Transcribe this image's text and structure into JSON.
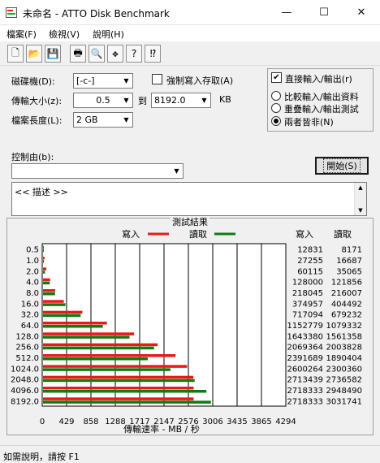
{
  "window": {
    "title": "未命名 - ATTO Disk Benchmark",
    "minimize": "—",
    "maximize": "☐",
    "close": "✕"
  },
  "menu": [
    "檔案(F)",
    "檢視(V)",
    "說明(H)"
  ],
  "toolbar": {
    "icons": [
      "new-icon",
      "open-icon",
      "save-icon",
      "print-icon",
      "print-preview-icon",
      "move-icon",
      "help-icon",
      "context-help-icon"
    ],
    "glyphs": [
      "🗋",
      "📂",
      "💾",
      "🖶",
      "🔍",
      "✥",
      "?",
      "⁉"
    ]
  },
  "settings": {
    "drive_label": "磁碟機(D):",
    "drive_value": "[-c-]",
    "transfer_label": "傳輸大小(z):",
    "transfer_from": "0.5",
    "to_label": "到",
    "transfer_to": "8192.0",
    "kb_label": "KB",
    "length_label": "檔案長度(L):",
    "length_value": "2 GB",
    "force_write_label": "強制寫入存取(A)",
    "force_write_checked": false,
    "direct_io_label": "直接輸入/輸出(r)",
    "direct_io_checked": true,
    "radio_compare": "比較輸入/輸出資料",
    "radio_overlap": "重疊輸入/輸出測試",
    "radio_neither": "兩者皆非(N)",
    "radio_selected": "neither",
    "control_label": "控制由(b):",
    "control_value": "",
    "start_label": "開始(S)",
    "description": "<< 描述 >>"
  },
  "results": {
    "title": "測試結果",
    "legend_write": "寫入",
    "legend_read": "讀取",
    "col_write": "寫入",
    "col_read": "讀取",
    "xlabel": "傳輸速率 - MB / 秒"
  },
  "chart_data": {
    "type": "bar",
    "orientation": "horizontal",
    "title": "測試結果",
    "xlabel": "傳輸速率 - MB / 秒",
    "xlim": [
      0,
      4294
    ],
    "xticks": [
      "0",
      "429",
      "858",
      "1288",
      "1717",
      "2147",
      "2576",
      "3006",
      "3435",
      "3865",
      "4294"
    ],
    "categories": [
      "0.5",
      "1.0",
      "2.0",
      "4.0",
      "8.0",
      "16.0",
      "32.0",
      "64.0",
      "128.0",
      "256.0",
      "512.0",
      "1024.0",
      "2048.0",
      "4096.0",
      "8192.0"
    ],
    "series": [
      {
        "name": "寫入",
        "color": "#e8191a",
        "values": [
          12.5,
          26.6,
          58.7,
          125.0,
          212.9,
          366.2,
          692.5,
          1125.8,
          1604.9,
          2020.9,
          2335.6,
          2539.3,
          2650.7,
          2654.6,
          2654.6
        ],
        "labels": [
          "12831",
          "27255",
          "60115",
          "128000",
          "218045",
          "374957",
          "717094",
          "1152779",
          "1643380",
          "2069364",
          "2391689",
          "2600264",
          "2713439",
          "2718333",
          "2718333"
        ]
      },
      {
        "name": "讀取",
        "color": "#0f7c0f",
        "values": [
          8.0,
          16.3,
          34.2,
          119.0,
          211.0,
          395.0,
          663.4,
          1054.0,
          1524.8,
          1956.9,
          1846.1,
          2246.5,
          2672.7,
          2879.8,
          2960.7
        ],
        "labels": [
          "8171",
          "16687",
          "35065",
          "121856",
          "216007",
          "404492",
          "679232",
          "1079332",
          "1561358",
          "2003828",
          "1890404",
          "2300360",
          "2736582",
          "2948490",
          "3031741"
        ]
      }
    ]
  },
  "status": "如需說明，請按 F1"
}
